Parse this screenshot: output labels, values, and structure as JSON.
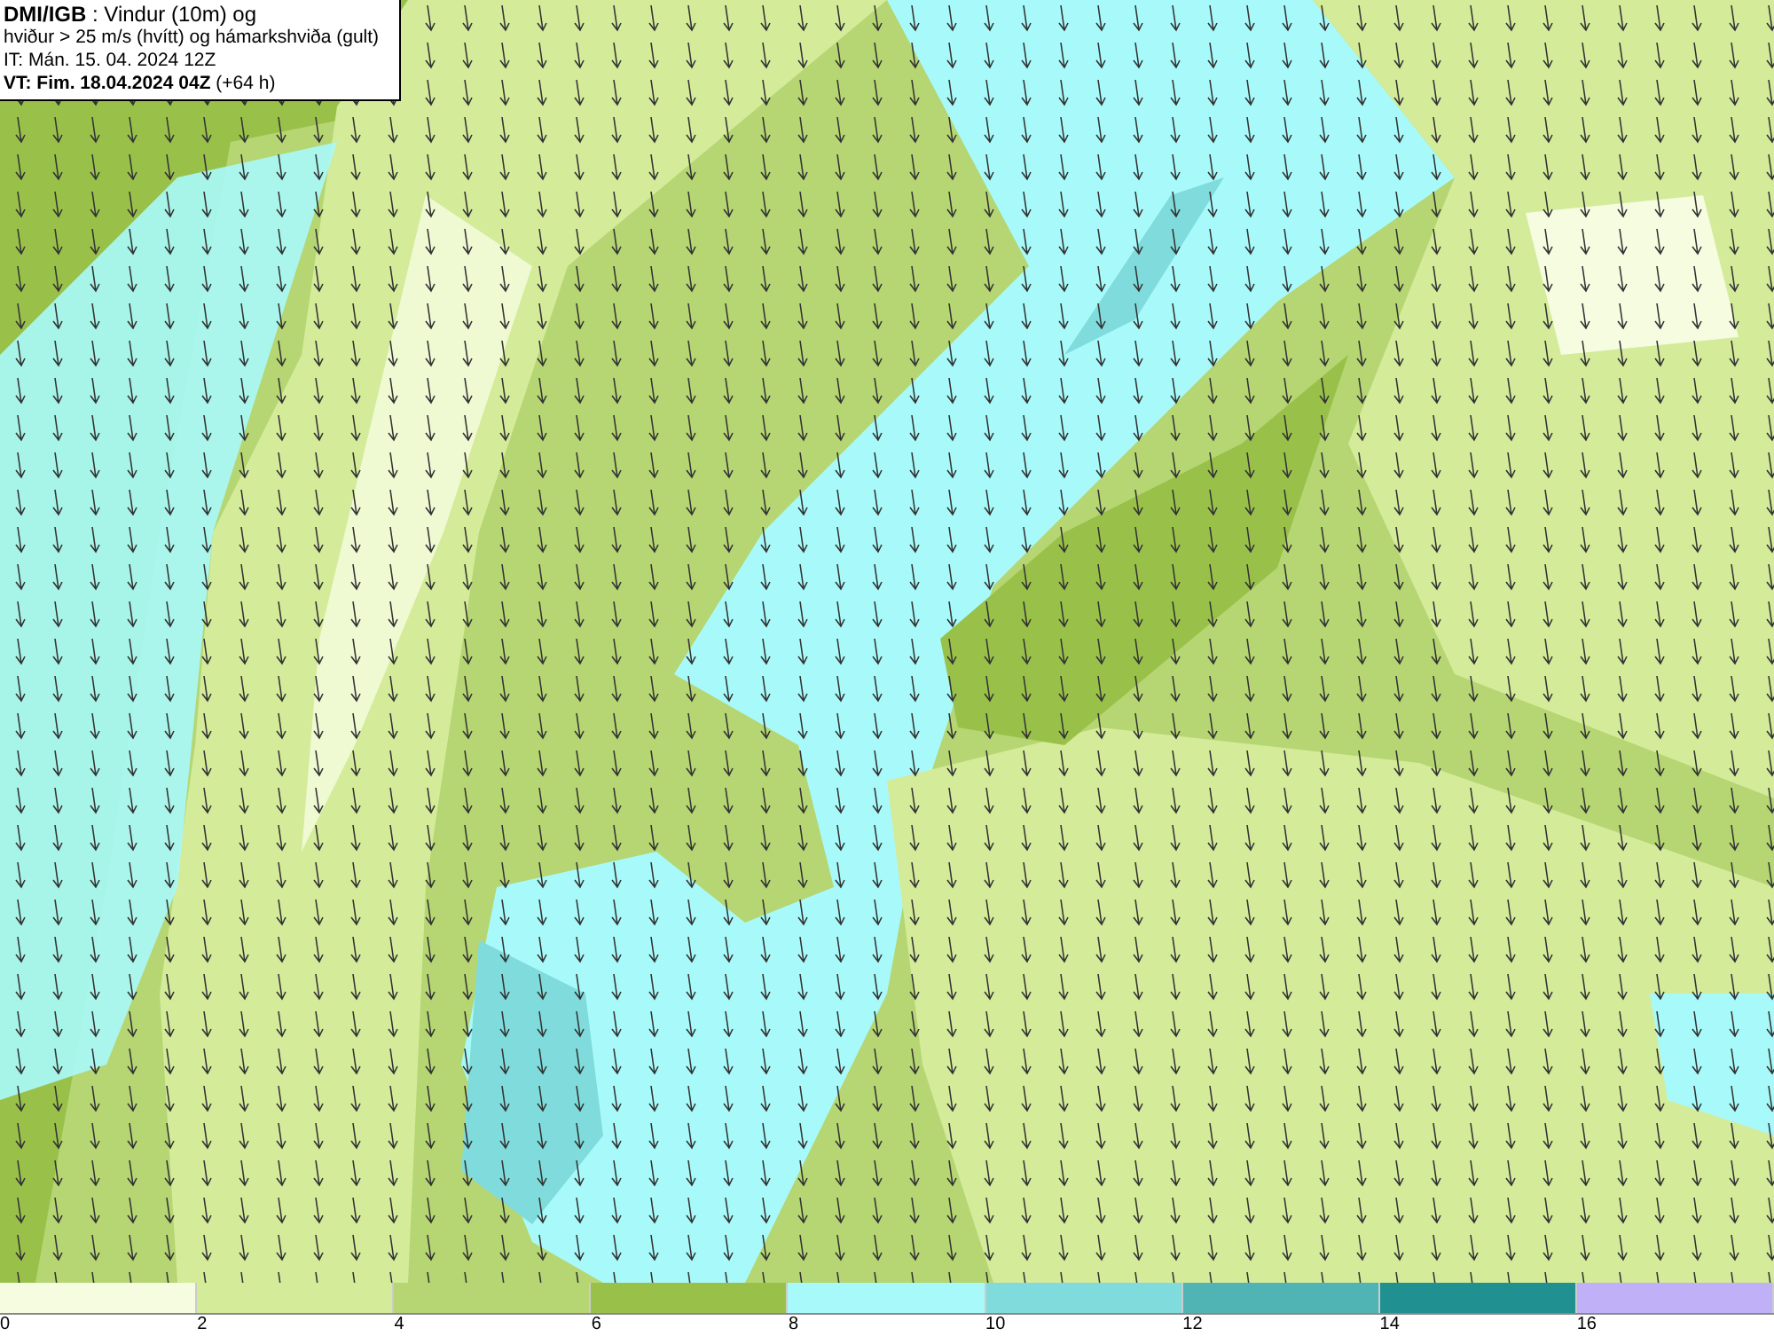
{
  "title_box": {
    "lines": [
      "**DMI/IGB** : Vindur (10m) og",
      "hviður > 25 m/s (hvítt) og hámarkshviða (gult)",
      "IT: Mán. 15. 04. 2024 12Z",
      "**VT: Fim. 18.04.2024 04Z** (+64 h)"
    ]
  },
  "legend": {
    "bins": [
      {
        "color": "#f5fce0"
      },
      {
        "color": "#d4eb9a"
      },
      {
        "color": "#b5d672"
      },
      {
        "color": "#99c14a"
      },
      {
        "color": "#a8fafa"
      },
      {
        "color": "#80dcdc"
      },
      {
        "color": "#50b4b4"
      },
      {
        "color": "#209090"
      },
      {
        "color": "#c0b0f8"
      }
    ],
    "ticks": [
      "0",
      "2",
      "4",
      "6",
      "8",
      "10",
      "12",
      "14",
      "16"
    ]
  }
}
